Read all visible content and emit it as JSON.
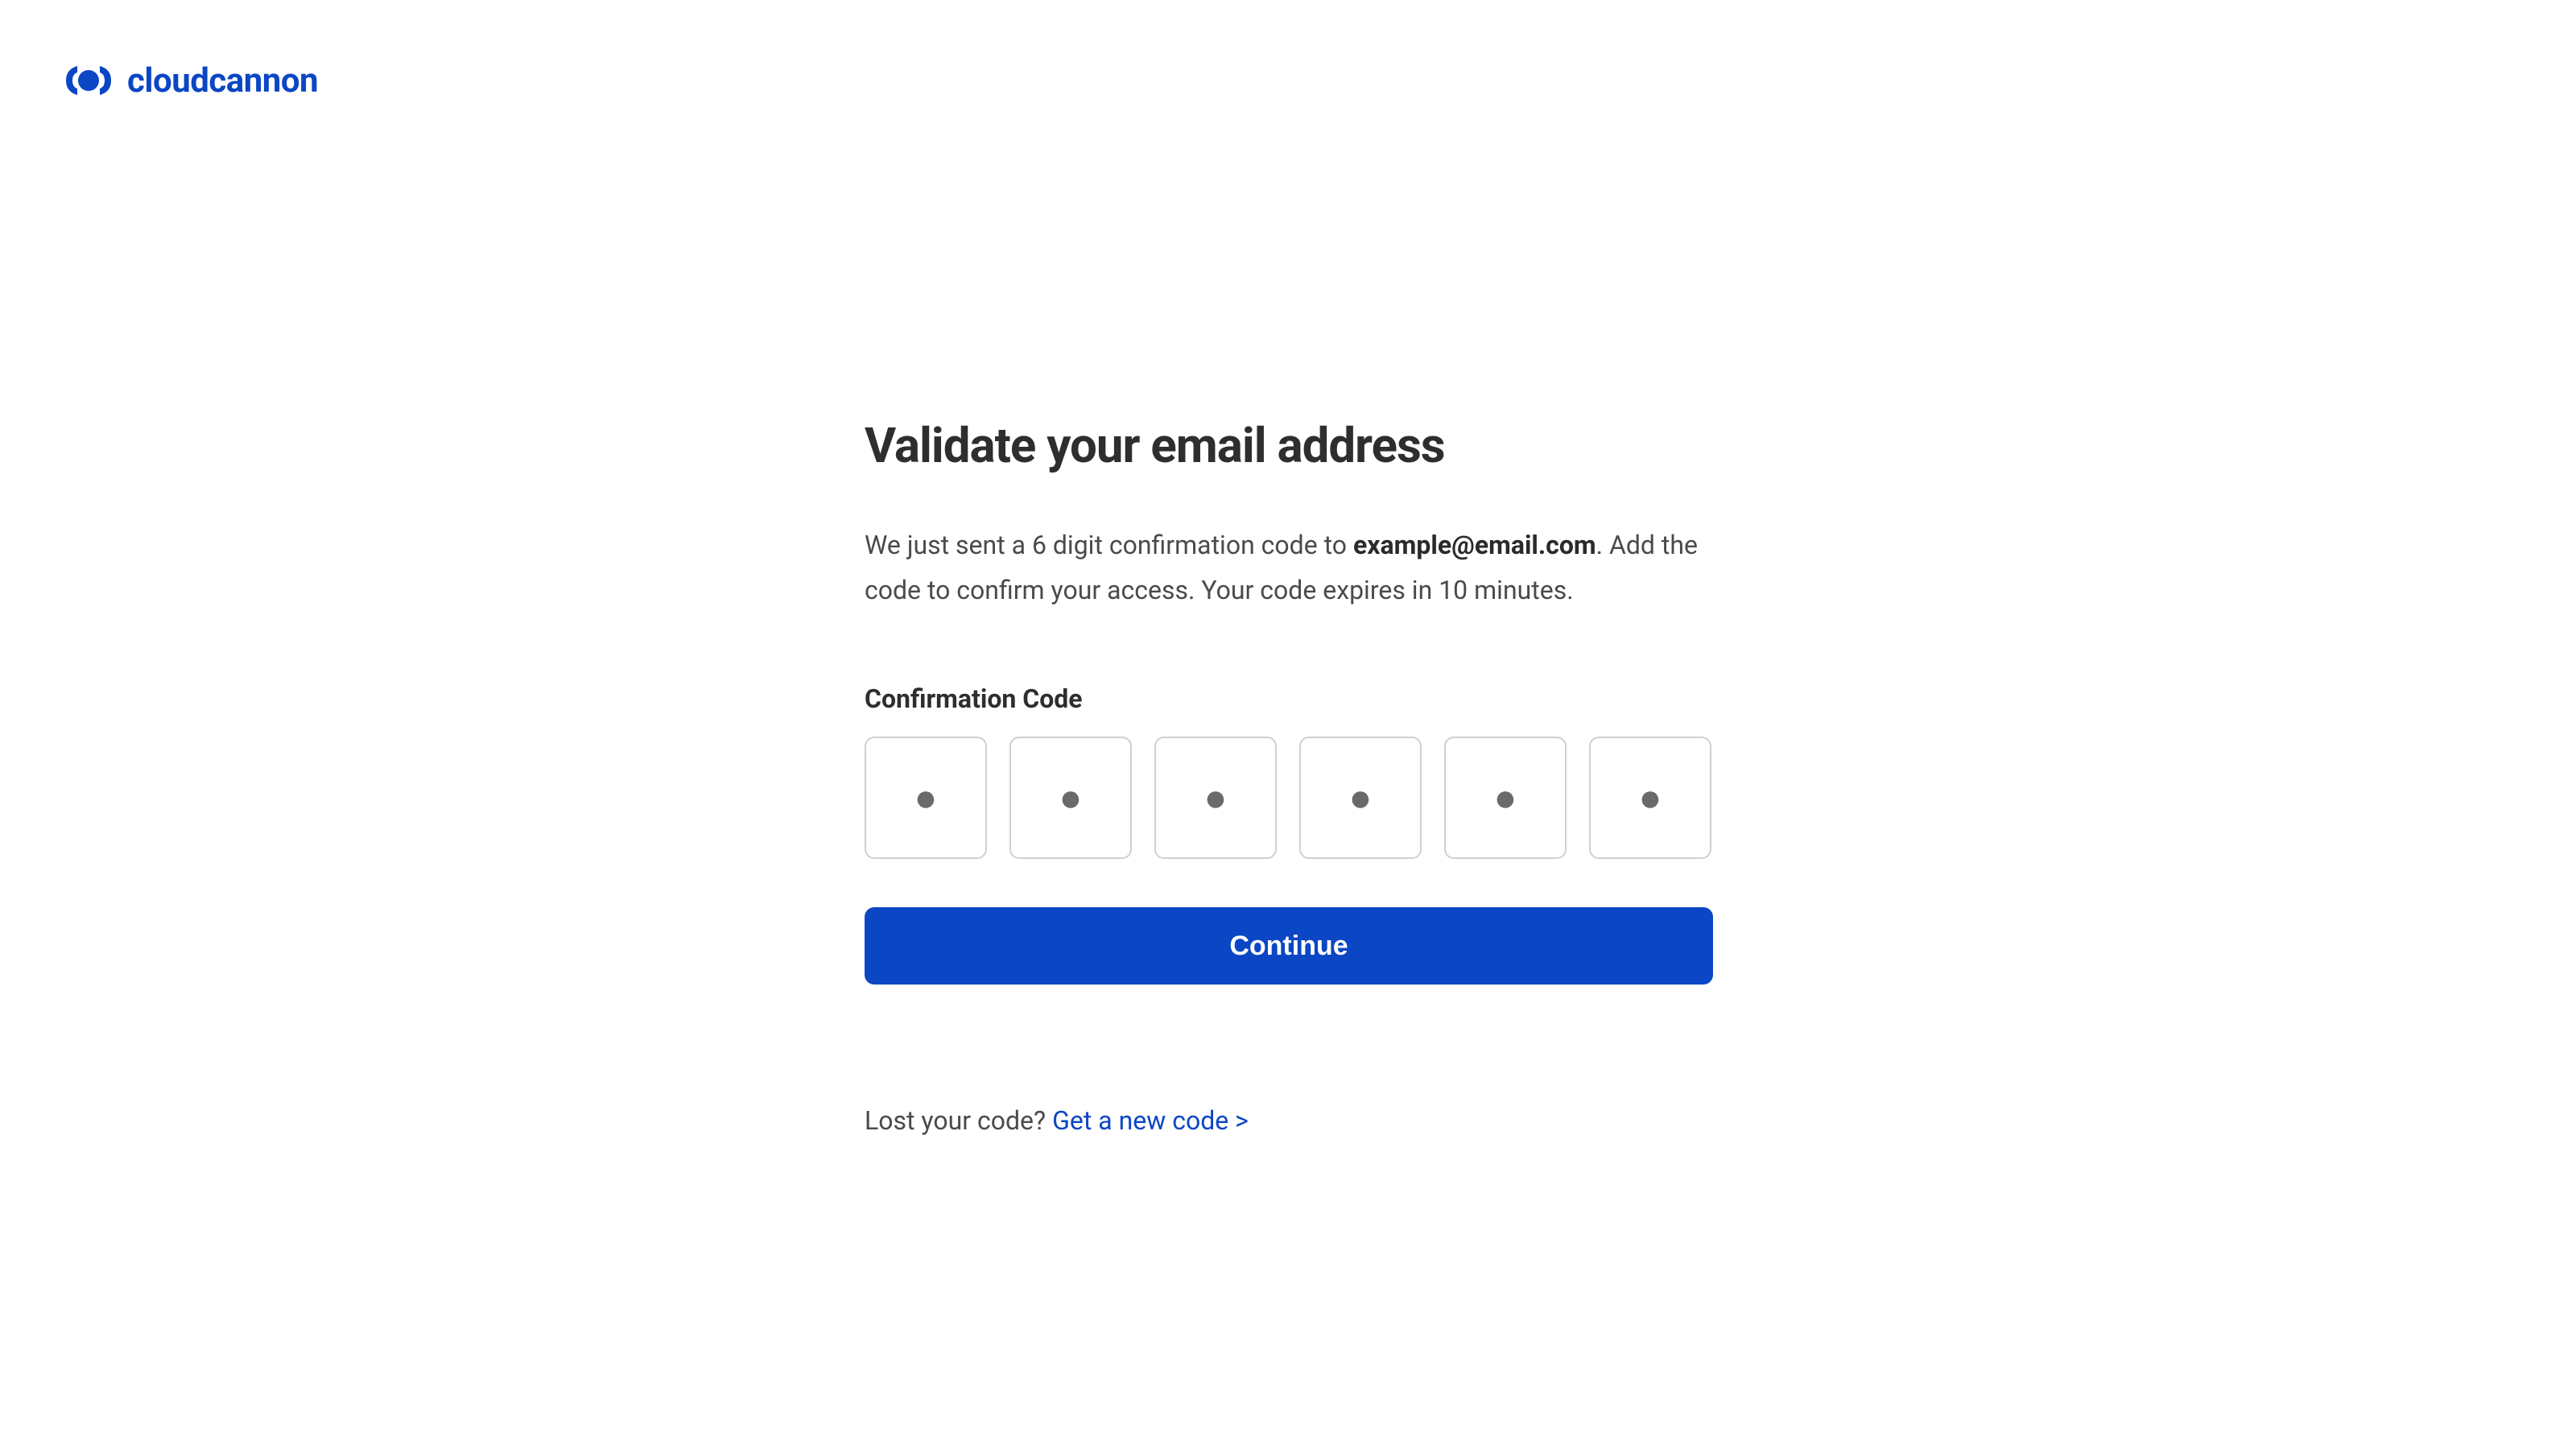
{
  "logo": {
    "text": "cloudcannon"
  },
  "main": {
    "title": "Validate your email address",
    "description_prefix": "We just sent a 6 digit confirmation code to ",
    "email": "example@email.com",
    "description_suffix": ". Add the code to confirm your access. Your code expires in 10 minutes.",
    "field_label": "Confirmation Code",
    "code_placeholder": "●",
    "continue_label": "Continue"
  },
  "footer": {
    "lost_code_text": "Lost your code? ",
    "new_code_link": "Get a new code >"
  }
}
